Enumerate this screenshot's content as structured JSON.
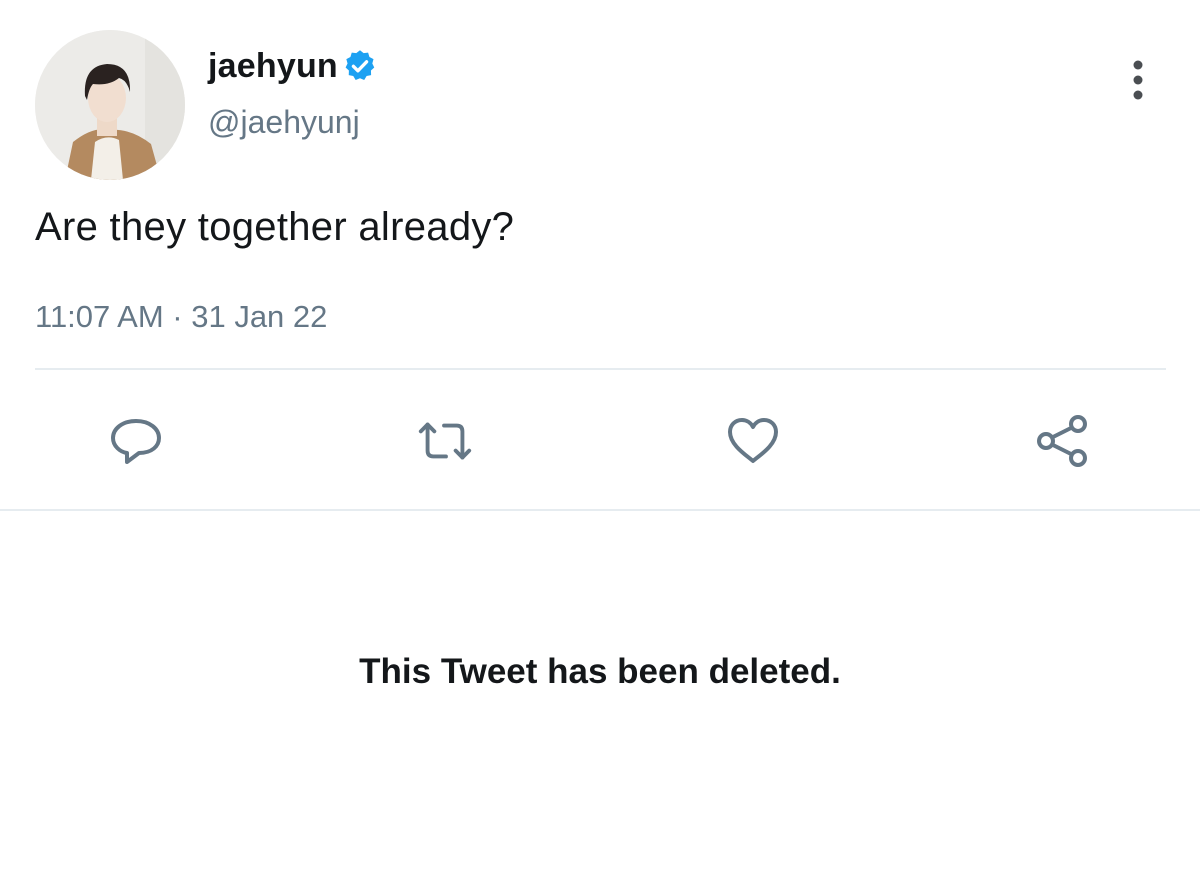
{
  "tweet": {
    "display_name": "jaehyun",
    "handle": "@jaehyunj",
    "verified_icon": "verified-badge-icon",
    "avatar_icon": "profile-photo",
    "more_icon": "more-options-icon",
    "text": "Are they together already?",
    "timestamp": "11:07 AM · 31 Jan 22"
  },
  "actions": {
    "reply_icon": "reply-icon",
    "retweet_icon": "retweet-icon",
    "like_icon": "heart-icon",
    "share_icon": "share-icon"
  },
  "deleted_notice": "This Tweet has been deleted.",
  "colors": {
    "verified_blue": "#1da1f2",
    "icon_gray": "#657786",
    "divider": "#e6ecf0",
    "text": "#14171a"
  }
}
